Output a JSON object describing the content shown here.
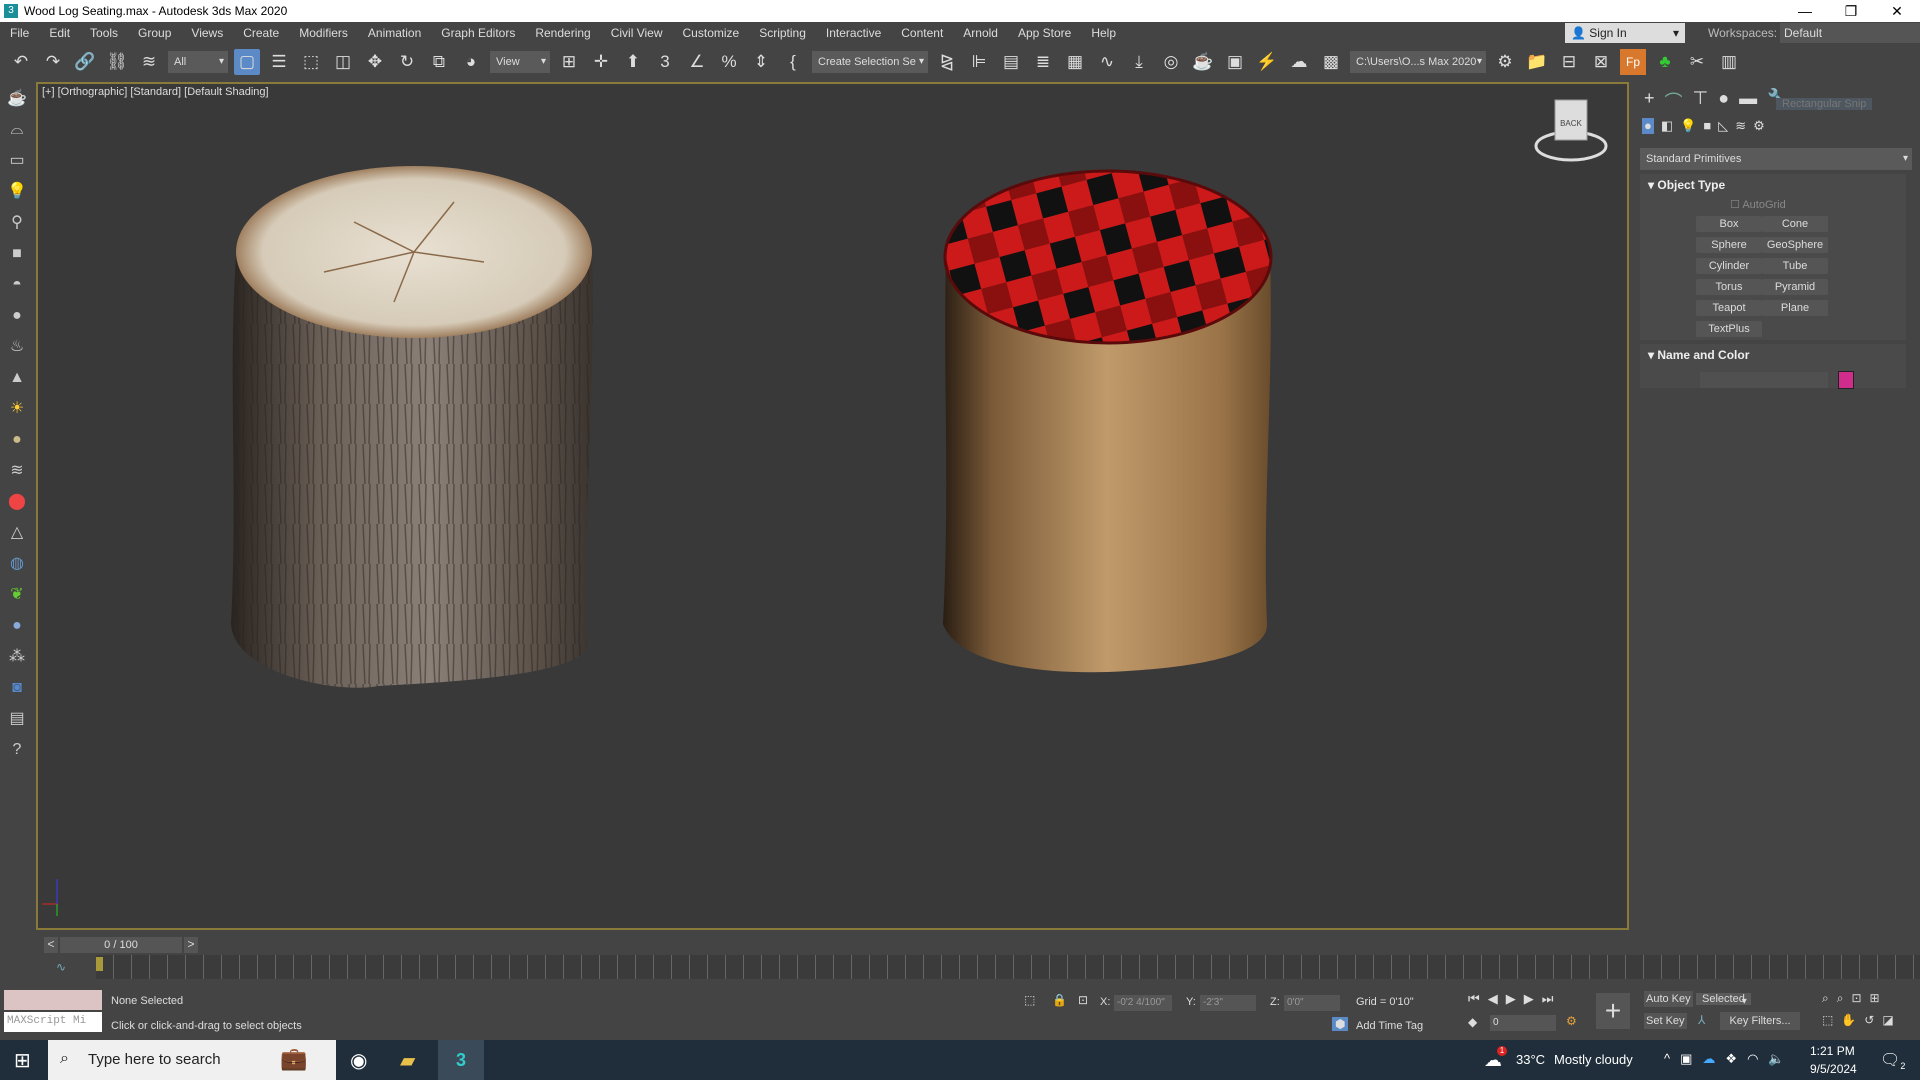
{
  "window": {
    "title": "Wood Log Seating.max - Autodesk 3ds Max 2020",
    "minimize": "—",
    "maximize": "❐",
    "close": "✕",
    "app_icon": "3"
  },
  "menu": [
    "File",
    "Edit",
    "Tools",
    "Group",
    "Views",
    "Create",
    "Modifiers",
    "Animation",
    "Graph Editors",
    "Rendering",
    "Civil View",
    "Customize",
    "Scripting",
    "Interactive",
    "Content",
    "Arnold",
    "App Store",
    "Help"
  ],
  "account": {
    "sign_in": "Sign In",
    "workspaces_label": "Workspaces:",
    "workspace": "Default"
  },
  "toolbar": {
    "selection_filter": "All",
    "ref_coord": "View",
    "named_selection": "Create Selection Se",
    "project_path": "C:\\Users\\O...s Max 2020"
  },
  "viewport": {
    "label": "[+] [Orthographic] [Standard] [Default Shading]",
    "viewcube": "BACK"
  },
  "command_panel": {
    "snip_overlay": "Rectangular Snip",
    "category": "Standard Primitives",
    "object_type": {
      "title": "Object Type",
      "autogrid": "AutoGrid",
      "buttons": [
        "Box",
        "Cone",
        "Sphere",
        "GeoSphere",
        "Cylinder",
        "Tube",
        "Torus",
        "Pyramid",
        "Teapot",
        "Plane",
        "TextPlus"
      ]
    },
    "name_color": {
      "title": "Name and Color",
      "name": "",
      "color": "#d02c8c"
    }
  },
  "timeline": {
    "frame": "0 / 100",
    "prev": "<",
    "next": ">"
  },
  "status": {
    "selection": "None Selected",
    "prompt": "Click or click-and-drag to select objects",
    "maxscript_placeholder": "MAXScript Mi",
    "x": "-0'2 4/100\"",
    "y": "-2'3\"",
    "z": "0'0\"",
    "grid": "Grid = 0'10\"",
    "add_time_tag": "Add Time Tag",
    "auto_key": "Auto Key",
    "set_key": "Set Key",
    "key_mode": "Selected",
    "key_filters": "Key Filters...",
    "current_frame": "0"
  },
  "taskbar": {
    "search_placeholder": "Type here to search",
    "weather_temp": "33°C",
    "weather": "Mostly cloudy",
    "time": "1:21 PM",
    "date": "9/5/2024",
    "notifications": "2",
    "weather_badge": "1"
  }
}
